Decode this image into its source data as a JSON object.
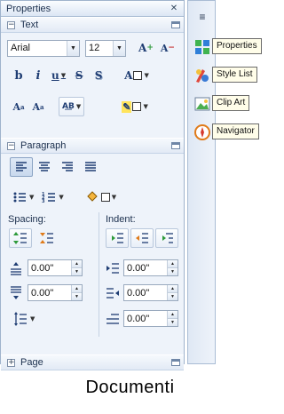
{
  "panel": {
    "title": "Properties",
    "text_section": {
      "label": "Text",
      "font_family": "Arial",
      "font_size": "12"
    },
    "paragraph_section": {
      "label": "Paragraph",
      "spacing_label": "Spacing:",
      "indent_label": "Indent:",
      "spacing_above": "0.00\"",
      "spacing_below": "0.00\"",
      "indent_before": "0.00\"",
      "indent_after": "0.00\"",
      "indent_first_line": "0.00\""
    },
    "page_section": {
      "label": "Page"
    }
  },
  "sidebar": {
    "items": [
      {
        "label": "Properties",
        "icon": "properties-icon"
      },
      {
        "label": "Style List",
        "icon": "style-list-icon"
      },
      {
        "label": "Clip Art",
        "icon": "clip-art-icon"
      },
      {
        "label": "Navigator",
        "icon": "navigator-icon"
      }
    ]
  },
  "caption": "Documenti",
  "colors": {
    "panel_bg": "#eef3fa",
    "border": "#9fb3cc",
    "accent": "#1f3d73"
  }
}
